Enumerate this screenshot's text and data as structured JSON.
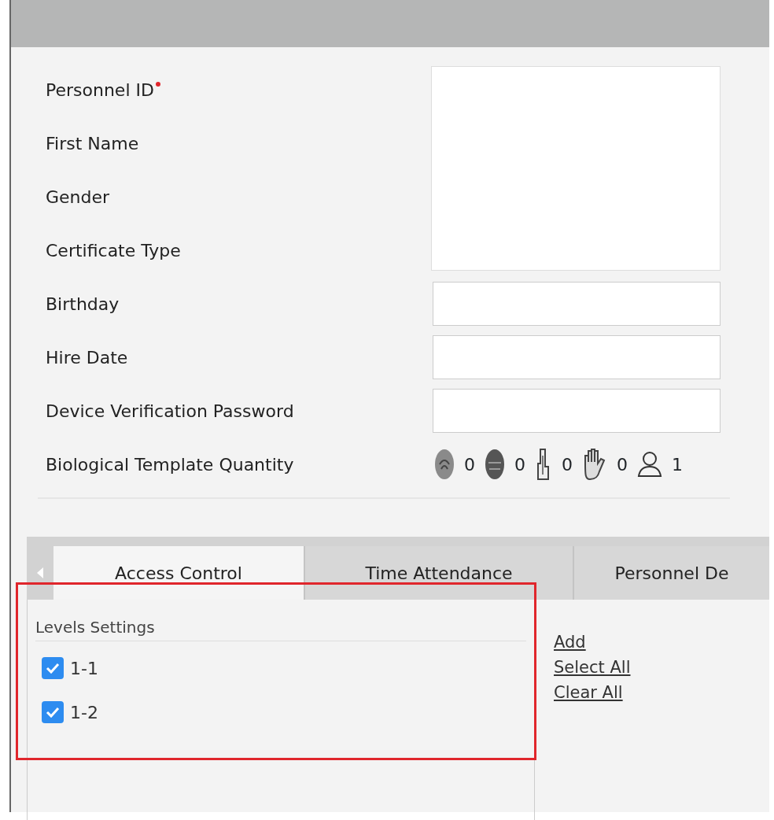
{
  "form": {
    "fields": [
      {
        "label": "Personnel ID",
        "required": true,
        "kind": "photo"
      },
      {
        "label": "First Name",
        "required": false,
        "kind": "none"
      },
      {
        "label": "Gender",
        "required": false,
        "kind": "none"
      },
      {
        "label": "Certificate Type",
        "required": false,
        "kind": "none"
      },
      {
        "label": "Birthday",
        "required": false,
        "kind": "input"
      },
      {
        "label": "Hire Date",
        "required": false,
        "kind": "input"
      },
      {
        "label": "Device Verification Password",
        "required": false,
        "kind": "input"
      },
      {
        "label": "Biological Template Quantity",
        "required": false,
        "kind": "biometrics"
      }
    ],
    "biometrics": [
      {
        "kind": "fingerprint",
        "count": "0"
      },
      {
        "kind": "face",
        "count": "0"
      },
      {
        "kind": "finger-vein",
        "count": "0"
      },
      {
        "kind": "palm",
        "count": "0"
      },
      {
        "kind": "person",
        "count": "1"
      }
    ]
  },
  "tabs": [
    {
      "label": "Access Control",
      "selected": true
    },
    {
      "label": "Time Attendance",
      "selected": false
    },
    {
      "label": "Personnel De",
      "selected": false
    }
  ],
  "levels": {
    "title": "Levels Settings",
    "items": [
      {
        "label": "1-1",
        "checked": true
      },
      {
        "label": "1-2",
        "checked": true
      }
    ]
  },
  "links": [
    "Add",
    "Select All",
    "Clear All"
  ],
  "highlight": true
}
